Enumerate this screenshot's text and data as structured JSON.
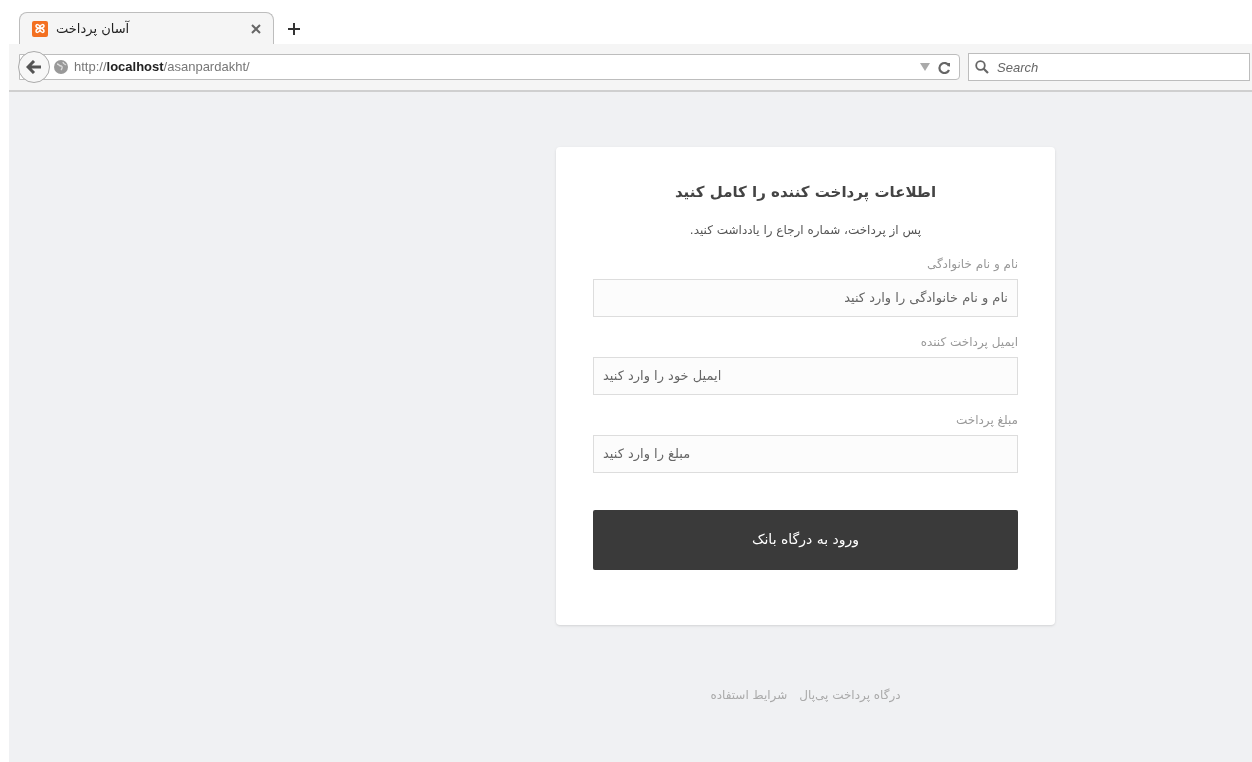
{
  "browser": {
    "tab": {
      "title": "آسان پرداخت",
      "selected": true
    },
    "address": {
      "scheme": "http://",
      "host": "localhost",
      "path": "/asanpardakht/"
    },
    "search": {
      "placeholder": "Search"
    }
  },
  "form": {
    "title": "اطلاعات پرداخت کننده را کامل کنید",
    "subtitle": "پس از پرداخت، شماره ارجاع را یادداشت کنید.",
    "fields": [
      {
        "label": "نام و نام خانوادگی",
        "placeholder": "نام و نام خانوادگی را وارد کنید",
        "kind": "text"
      },
      {
        "label": "ایمیل پرداخت کننده",
        "placeholder": "ایمیل خود را وارد کنید",
        "kind": "email"
      },
      {
        "label": "مبلغ پرداخت",
        "placeholder": "مبلغ را وارد کنید",
        "kind": "number"
      }
    ],
    "submit": "ورود به درگاه بانک"
  },
  "footer": {
    "links": [
      "درگاه پرداخت پی‌پال",
      "شرایط استفاده"
    ]
  }
}
